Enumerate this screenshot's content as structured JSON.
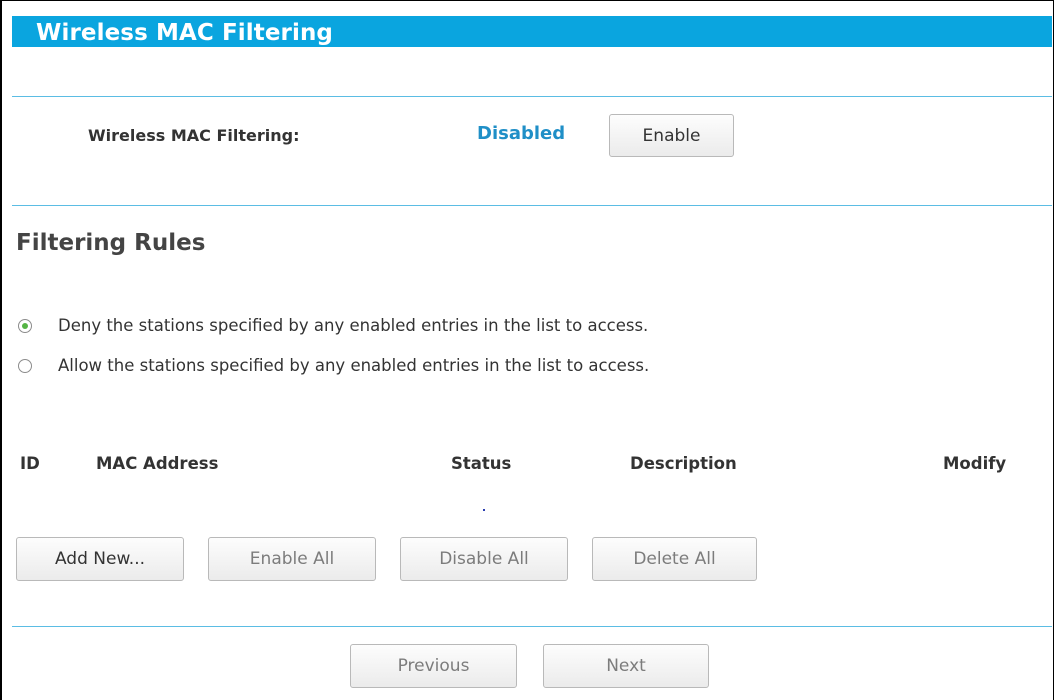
{
  "header": {
    "title": "Wireless MAC Filtering"
  },
  "filter_status": {
    "label": "Wireless MAC Filtering:",
    "value": "Disabled",
    "enable_button": "Enable"
  },
  "rules": {
    "title": "Filtering Rules",
    "options": [
      {
        "label": "Deny the stations specified by any enabled entries in the list to access.",
        "selected": true
      },
      {
        "label": "Allow the stations specified by any enabled entries in the list to access.",
        "selected": false
      }
    ]
  },
  "table": {
    "headers": [
      "ID",
      "MAC Address",
      "Status",
      "Description",
      "Modify"
    ]
  },
  "actions": {
    "add_new": "Add New...",
    "enable_all": "Enable All",
    "disable_all": "Disable All",
    "delete_all": "Delete All"
  },
  "pagination": {
    "previous": "Previous",
    "next": "Next"
  },
  "colors": {
    "header_bg": "#0aa5df",
    "status_text": "#1f8fc7",
    "radio_selected": "#55b445"
  }
}
